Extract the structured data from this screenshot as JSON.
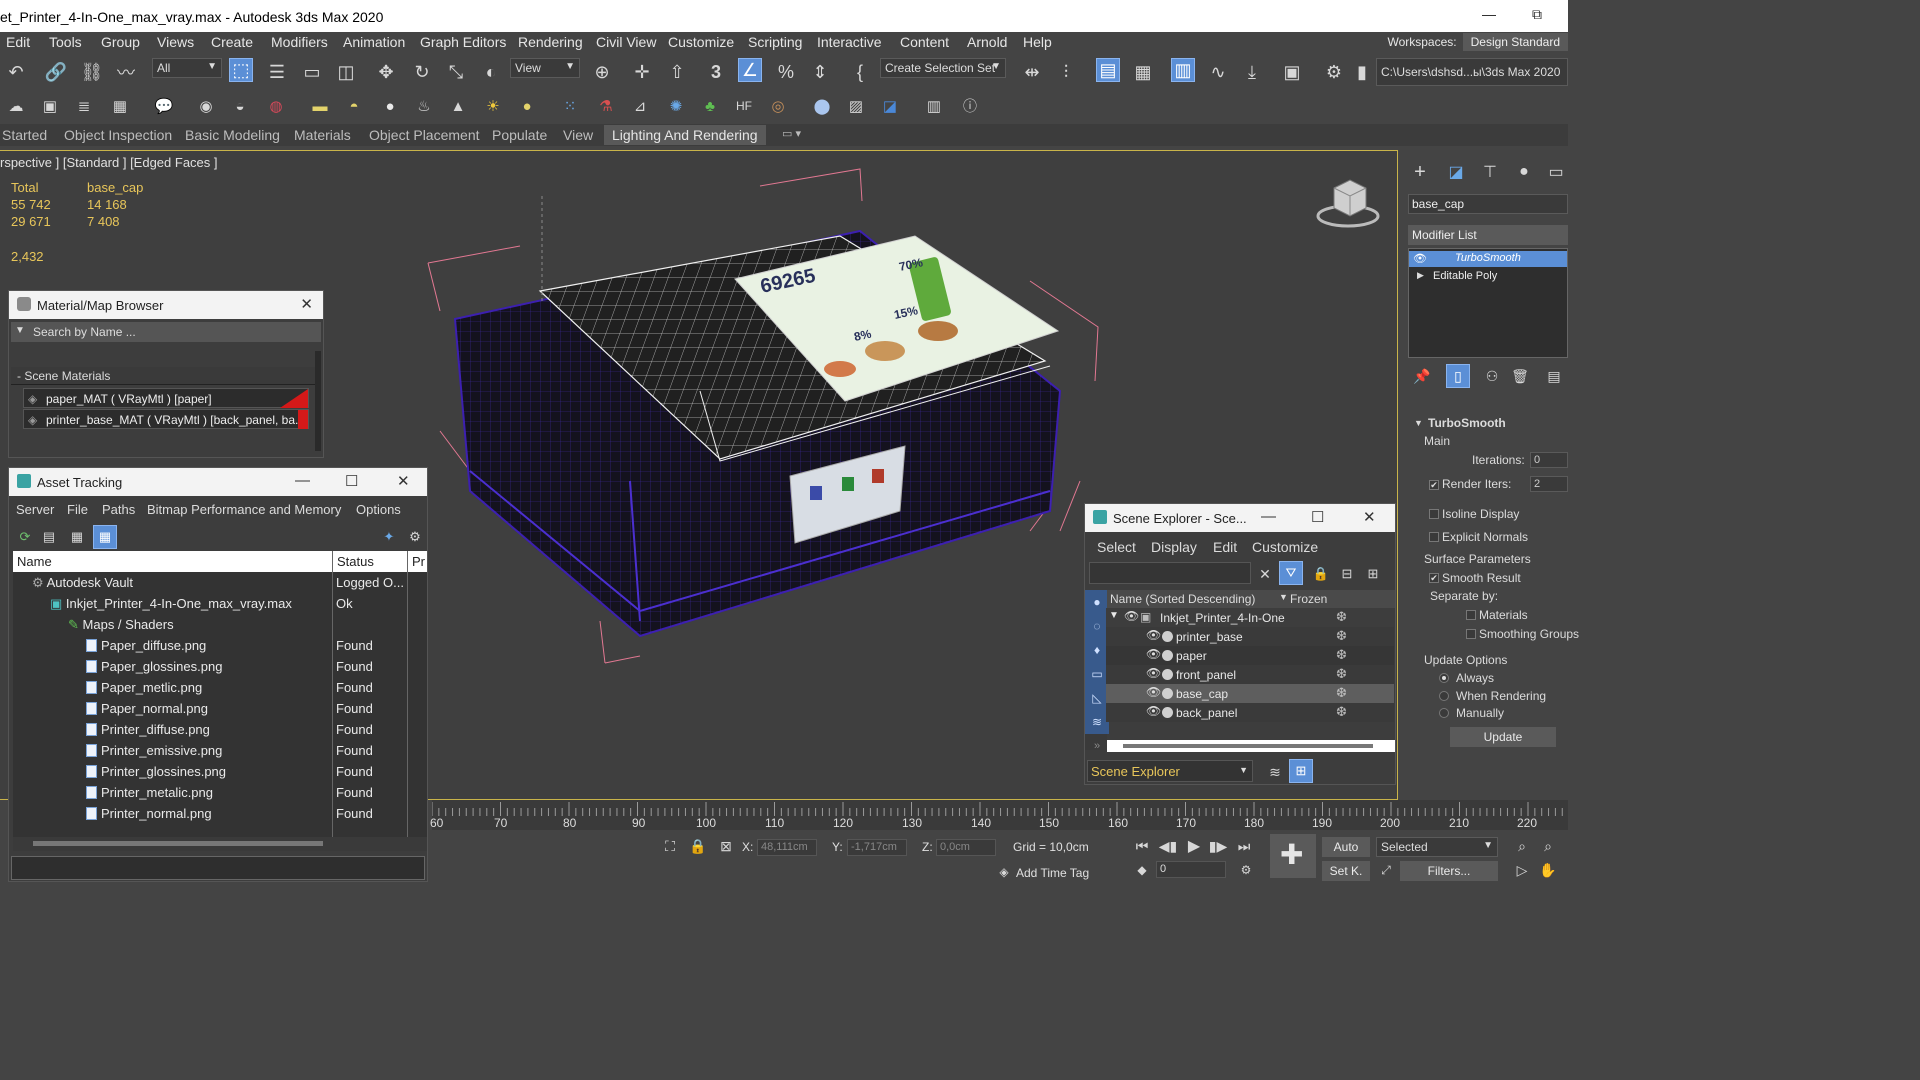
{
  "window": {
    "title": "et_Printer_4-In-One_max_vray.max - Autodesk 3ds Max 2020",
    "min_glyph": "—",
    "restore_glyph": "⧉"
  },
  "menu": [
    "Edit",
    "Tools",
    "Group",
    "Views",
    "Create",
    "Modifiers",
    "Animation",
    "Graph Editors",
    "Rendering",
    "Civil View",
    "Customize",
    "Scripting",
    "Interactive",
    "Content",
    "Arnold",
    "Help"
  ],
  "workspace": {
    "label": "Workspaces:",
    "value": "Design Standard"
  },
  "toolbar": {
    "filter_value": "All",
    "coord_value": "View",
    "selection_set": "Create Selection Set",
    "path": "C:\\Users\\dshsd...ы\\3ds Max 2020",
    "snap_3": "3"
  },
  "ribbon_tabs": [
    "Started",
    "Object Inspection",
    "Basic Modeling",
    "Materials",
    "Object Placement",
    "Populate",
    "View",
    "Lighting And Rendering"
  ],
  "viewport": {
    "label": "rspective ] [Standard ] [Edged Faces ]",
    "stats": {
      "col1_header": "Total",
      "col2_header": "base_cap",
      "r1c1": "55 742",
      "r1c2": "14 168",
      "r2c1": "29 671",
      "r2c2": "7 408",
      "fps": "2,432"
    },
    "screen": {
      "big_number": "69265",
      "pct1": "70%",
      "pct2": "15%",
      "pct3": "8%"
    }
  },
  "material_browser": {
    "title": "Material/Map Browser",
    "search_placeholder": "Search by Name ...",
    "section": "- Scene Materials",
    "items": [
      "paper_MAT  ( VRayMtl )  [paper]",
      "printer_base_MAT  ( VRayMtl )  [back_panel, ba..."
    ],
    "accent": "#d41919"
  },
  "asset_tracking": {
    "title": "Asset Tracking",
    "menu": [
      "Server",
      "File",
      "Paths",
      "Bitmap Performance and Memory",
      "Options"
    ],
    "columns": [
      "Name",
      "Status",
      "Pr"
    ],
    "rows": [
      {
        "name": "Autodesk Vault",
        "status": "Logged O..."
      },
      {
        "name": "Inkjet_Printer_4-In-One_max_vray.max",
        "status": "Ok"
      },
      {
        "name": "Maps / Shaders",
        "status": ""
      },
      {
        "name": "Paper_diffuse.png",
        "status": "Found"
      },
      {
        "name": "Paper_glossines.png",
        "status": "Found"
      },
      {
        "name": "Paper_metlic.png",
        "status": "Found"
      },
      {
        "name": "Paper_normal.png",
        "status": "Found"
      },
      {
        "name": "Printer_diffuse.png",
        "status": "Found"
      },
      {
        "name": "Printer_emissive.png",
        "status": "Found"
      },
      {
        "name": "Printer_glossines.png",
        "status": "Found"
      },
      {
        "name": "Printer_metalic.png",
        "status": "Found"
      },
      {
        "name": "Printer_normal.png",
        "status": "Found"
      }
    ]
  },
  "scene_explorer": {
    "title": "Scene Explorer - Sce...",
    "menu": [
      "Select",
      "Display",
      "Edit",
      "Customize"
    ],
    "col_name": "Name (Sorted Descending)",
    "col_frozen": "Frozen",
    "root": "Inkjet_Printer_4-In-One",
    "children": [
      "printer_base",
      "paper",
      "front_panel",
      "base_cap",
      "back_panel"
    ],
    "selected": "base_cap",
    "footer": "Scene Explorer"
  },
  "command_panel": {
    "object_name": "base_cap",
    "modifier_list": "Modifier List",
    "stack": [
      "TurboSmooth",
      "Editable Poly"
    ],
    "rollout": "TurboSmooth",
    "main": "Main",
    "iterations_label": "Iterations:",
    "iterations_value": "0",
    "render_iters_label": "Render Iters:",
    "render_iters_value": "2",
    "isoline": "Isoline Display",
    "explicit_normals": "Explicit Normals",
    "surface_params": "Surface Parameters",
    "smooth_result": "Smooth Result",
    "separate_by": "Separate by:",
    "materials": "Materials",
    "smoothing_groups": "Smoothing Groups",
    "update_options": "Update Options",
    "always": "Always",
    "when_rendering": "When Rendering",
    "manually": "Manually",
    "update_btn": "Update"
  },
  "timeline": {
    "ticks": [
      "60",
      "70",
      "80",
      "90",
      "100",
      "110",
      "120",
      "130",
      "140",
      "150",
      "160",
      "170",
      "180",
      "190",
      "200",
      "210",
      "220"
    ]
  },
  "status": {
    "x_label": "X:",
    "x_value": "48,111cm",
    "y_label": "Y:",
    "y_value": "-1,717cm",
    "z_label": "Z:",
    "z_value": "0,0cm",
    "grid": "Grid = 10,0cm",
    "add_time_tag": "Add Time Tag",
    "frame_value": "0",
    "auto": "Auto",
    "set_key": "Set K.",
    "selected": "Selected",
    "filters": "Filters..."
  }
}
